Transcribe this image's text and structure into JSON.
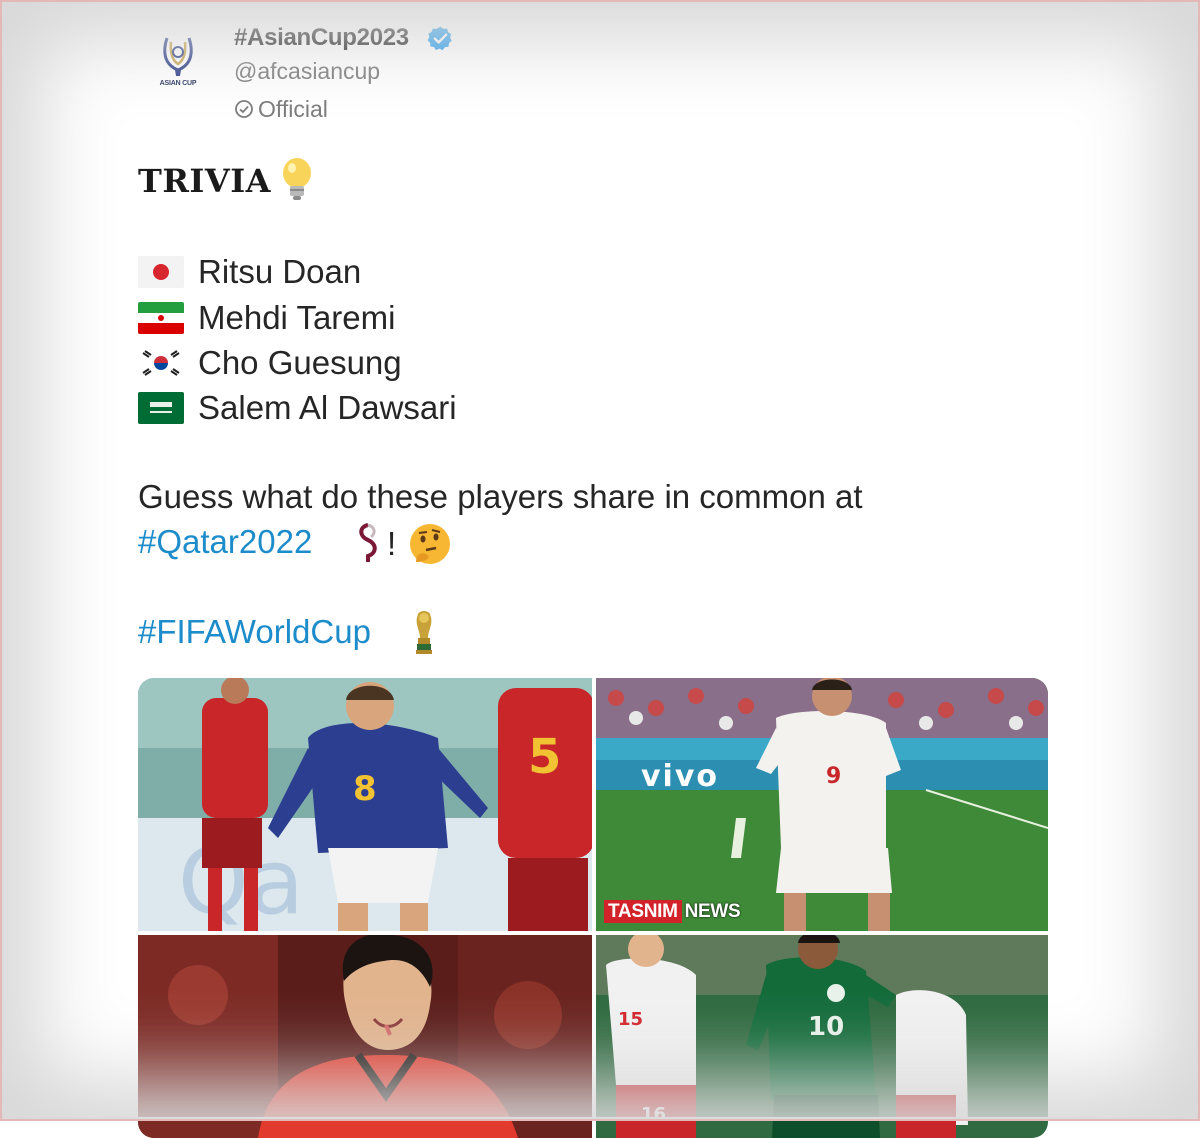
{
  "account": {
    "display_name": "#AsianCup2023",
    "handle": "@afcasiancup",
    "label": "Official",
    "avatar_text": "ASIAN CUP"
  },
  "tweet": {
    "heading": "TRIVIA",
    "players": [
      {
        "name": "Ritsu Doan",
        "flag": "japan-flag-icon"
      },
      {
        "name": "Mehdi Taremi",
        "flag": "iran-flag-icon"
      },
      {
        "name": "Cho Guesung",
        "flag": "south-korea-flag-icon"
      },
      {
        "name": "Salem Al Dawsari",
        "flag": "saudi-arabia-flag-icon"
      }
    ],
    "question": "Guess what do these players share in common at",
    "hashtag_qatar": "#Qatar2022",
    "exclamation": "!",
    "hashtag_fifa": "#FIFAWorldCup"
  },
  "media": {
    "photo_1": {
      "shirt_number": "8",
      "ad_text": "Qa"
    },
    "photo_2": {
      "ad_text": "vivo",
      "shirt_number": "9",
      "watermark_1": "TASNIM",
      "watermark_2": "NEWS"
    },
    "photo_3": {},
    "photo_4": {
      "shirt_number": "10",
      "opponent_number": "16"
    }
  },
  "colors": {
    "hashtag": "#1d8ccb",
    "verified": "#1d9bf0",
    "secondary_text": "#7a7a7a",
    "watermark_red": "#d2232a"
  }
}
